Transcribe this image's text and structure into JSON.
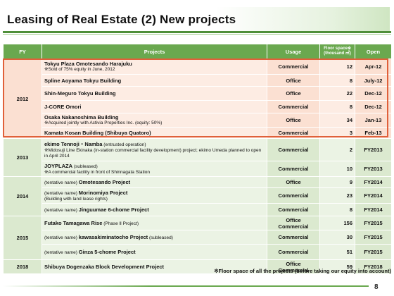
{
  "title": "Leasing of Real Estate (2) New projects",
  "headers": {
    "fy": "FY",
    "projects": "Projects",
    "usage": "Usage",
    "floor": "Floor space※ (thousand ㎡)",
    "open": "Open"
  },
  "rows": [
    {
      "fy": "2012",
      "name": "Tokyu Plaza Omotesando Harajuku",
      "note": "※Sold of 75% equity in June, 2012",
      "usage": "Commercial",
      "floor": "12",
      "open": "Apr-12"
    },
    {
      "name": "Spline Aoyama Tokyu Building",
      "usage": "Office",
      "floor": "8",
      "open": "July-12"
    },
    {
      "name": "Shin-Meguro Tokyu Building",
      "usage": "Office",
      "floor": "22",
      "open": "Dec-12"
    },
    {
      "name": "J-CORE Omori",
      "usage": "Commercial",
      "floor": "8",
      "open": "Dec-12"
    },
    {
      "name": "Osaka Nakanoshima Building",
      "note": "※Acquired jointly with Activia Properties Inc. (equity: 50%)",
      "usage": "Office",
      "floor": "34",
      "open": "Jan-13"
    },
    {
      "name": "Kamata Kosan Building (Shibuya Quatoro)",
      "usage": "Commercial",
      "floor": "3",
      "open": "Feb-13"
    },
    {
      "fy": "2013",
      "name": "ekimo Tennoji・Namba",
      "tag": " (entrusted operation)",
      "note": "※Midosuji Line Ekinaka (in-station commercial facility development) project; ekimo Umeda planned to open in April 2014",
      "usage": "Commercial",
      "floor": "2",
      "open": "FY2013"
    },
    {
      "name": "JOYPLAZA",
      "tag": " (subleased)",
      "note": "※A commercial facility in front of Shinnagata Station",
      "usage": "Commercial",
      "floor": "10",
      "open": "FY2013"
    },
    {
      "fy": "2014",
      "prefix": "(tentative name) ",
      "name": "Omotesando Project",
      "usage": "Office",
      "floor": "9",
      "open": "FY2014"
    },
    {
      "prefix": "(tentative name) ",
      "name": "Morinomiya Project",
      "note": "(Building with land lease rights)",
      "usage": "Commercial",
      "floor": "23",
      "open": "FY2014"
    },
    {
      "prefix": "(tentative name) ",
      "name": "Jinguumae 6-chome Project",
      "usage": "Commercial",
      "floor": "8",
      "open": "FY2014"
    },
    {
      "fy": "2015",
      "name": "Futako Tamagawa Rise",
      "tag": " (Phase Ⅱ Project)",
      "usage": "Office\nCommercial",
      "floor": "156",
      "open": "FY2015"
    },
    {
      "prefix": "(tentative name) ",
      "name": "kawasakiminatocho Project",
      "tag": " (subleased)",
      "usage": "Commercial",
      "floor": "30",
      "open": "FY2015"
    },
    {
      "prefix": "(tentative name) ",
      "name": "Ginza 5-chome Project",
      "usage": "Commercial",
      "floor": "51",
      "open": "FY2015"
    },
    {
      "fy": "2018",
      "name": "Shibuya Dogenzaka Block Development Project",
      "usage": "Office\nCommercial",
      "floor": "59",
      "open": "FY2018"
    }
  ],
  "footnote": "※Floor space of all the projects (before taking our equity into account)",
  "page_number": "8",
  "colors": {
    "header_green": "#6aa84f",
    "highlight_border": "#e0603a",
    "highlight_fill": "#fdece3"
  }
}
